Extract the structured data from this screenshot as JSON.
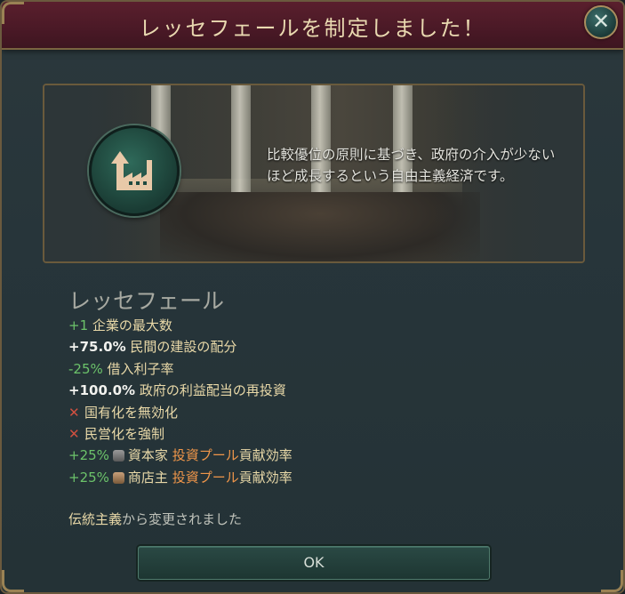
{
  "dialog": {
    "title": "レッセフェールを制定しました！",
    "close_icon": "close-icon"
  },
  "banner": {
    "icon": "factory-growth-icon",
    "description": "比較優位の原則に基づき、政府の介入が少ないほど成長するという自由主義経済です。"
  },
  "law": {
    "name": "レッセフェール"
  },
  "effects": [
    {
      "value": "+1",
      "value_style": "green",
      "label": "企業の最大数"
    },
    {
      "value": "+75.0%",
      "value_style": "white",
      "label": "民間の建設の配分"
    },
    {
      "value": "-25%",
      "value_style": "green",
      "label": "借入利子率"
    },
    {
      "value": "+100.0%",
      "value_style": "white",
      "label": "政府の利益配当の再投資"
    },
    {
      "icon": "cross-icon",
      "label": "国有化を無効化"
    },
    {
      "icon": "cross-icon",
      "label": "民営化を強制"
    },
    {
      "value": "+25%",
      "value_style": "green",
      "pop_icon": "capitalist-icon",
      "pop": "資本家",
      "highlight": "投資プール",
      "label": "貢献効率"
    },
    {
      "value": "+25%",
      "value_style": "green",
      "pop_icon": "shopkeeper-icon",
      "pop": "商店主",
      "highlight": "投資プール",
      "label": "貢献効率"
    }
  ],
  "footer": {
    "previous_law": "伝統主義",
    "suffix": "から変更されました"
  },
  "ok_button": {
    "label": "OK"
  }
}
